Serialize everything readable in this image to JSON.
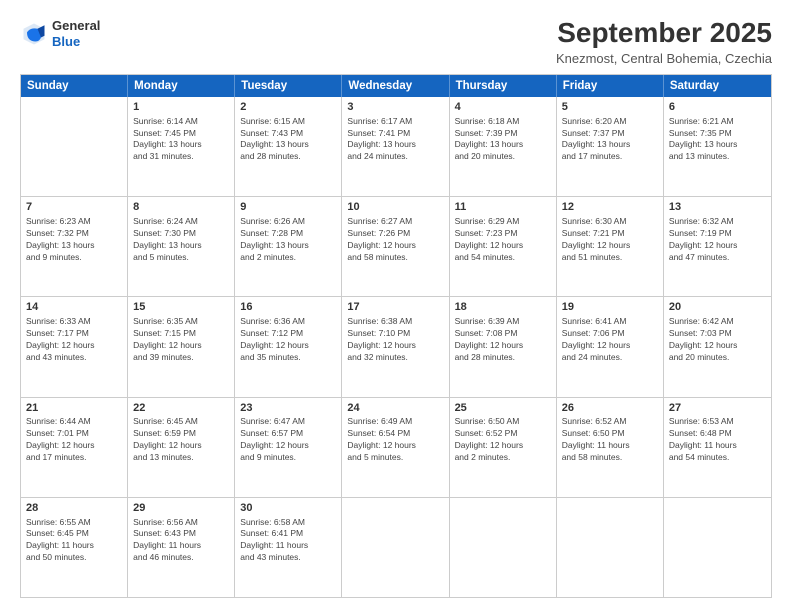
{
  "header": {
    "logo_line1": "General",
    "logo_line2": "Blue",
    "month": "September 2025",
    "location": "Knezmost, Central Bohemia, Czechia"
  },
  "weekdays": [
    "Sunday",
    "Monday",
    "Tuesday",
    "Wednesday",
    "Thursday",
    "Friday",
    "Saturday"
  ],
  "rows": [
    [
      {
        "day": "",
        "lines": []
      },
      {
        "day": "1",
        "lines": [
          "Sunrise: 6:14 AM",
          "Sunset: 7:45 PM",
          "Daylight: 13 hours",
          "and 31 minutes."
        ]
      },
      {
        "day": "2",
        "lines": [
          "Sunrise: 6:15 AM",
          "Sunset: 7:43 PM",
          "Daylight: 13 hours",
          "and 28 minutes."
        ]
      },
      {
        "day": "3",
        "lines": [
          "Sunrise: 6:17 AM",
          "Sunset: 7:41 PM",
          "Daylight: 13 hours",
          "and 24 minutes."
        ]
      },
      {
        "day": "4",
        "lines": [
          "Sunrise: 6:18 AM",
          "Sunset: 7:39 PM",
          "Daylight: 13 hours",
          "and 20 minutes."
        ]
      },
      {
        "day": "5",
        "lines": [
          "Sunrise: 6:20 AM",
          "Sunset: 7:37 PM",
          "Daylight: 13 hours",
          "and 17 minutes."
        ]
      },
      {
        "day": "6",
        "lines": [
          "Sunrise: 6:21 AM",
          "Sunset: 7:35 PM",
          "Daylight: 13 hours",
          "and 13 minutes."
        ]
      }
    ],
    [
      {
        "day": "7",
        "lines": [
          "Sunrise: 6:23 AM",
          "Sunset: 7:32 PM",
          "Daylight: 13 hours",
          "and 9 minutes."
        ]
      },
      {
        "day": "8",
        "lines": [
          "Sunrise: 6:24 AM",
          "Sunset: 7:30 PM",
          "Daylight: 13 hours",
          "and 5 minutes."
        ]
      },
      {
        "day": "9",
        "lines": [
          "Sunrise: 6:26 AM",
          "Sunset: 7:28 PM",
          "Daylight: 13 hours",
          "and 2 minutes."
        ]
      },
      {
        "day": "10",
        "lines": [
          "Sunrise: 6:27 AM",
          "Sunset: 7:26 PM",
          "Daylight: 12 hours",
          "and 58 minutes."
        ]
      },
      {
        "day": "11",
        "lines": [
          "Sunrise: 6:29 AM",
          "Sunset: 7:23 PM",
          "Daylight: 12 hours",
          "and 54 minutes."
        ]
      },
      {
        "day": "12",
        "lines": [
          "Sunrise: 6:30 AM",
          "Sunset: 7:21 PM",
          "Daylight: 12 hours",
          "and 51 minutes."
        ]
      },
      {
        "day": "13",
        "lines": [
          "Sunrise: 6:32 AM",
          "Sunset: 7:19 PM",
          "Daylight: 12 hours",
          "and 47 minutes."
        ]
      }
    ],
    [
      {
        "day": "14",
        "lines": [
          "Sunrise: 6:33 AM",
          "Sunset: 7:17 PM",
          "Daylight: 12 hours",
          "and 43 minutes."
        ]
      },
      {
        "day": "15",
        "lines": [
          "Sunrise: 6:35 AM",
          "Sunset: 7:15 PM",
          "Daylight: 12 hours",
          "and 39 minutes."
        ]
      },
      {
        "day": "16",
        "lines": [
          "Sunrise: 6:36 AM",
          "Sunset: 7:12 PM",
          "Daylight: 12 hours",
          "and 35 minutes."
        ]
      },
      {
        "day": "17",
        "lines": [
          "Sunrise: 6:38 AM",
          "Sunset: 7:10 PM",
          "Daylight: 12 hours",
          "and 32 minutes."
        ]
      },
      {
        "day": "18",
        "lines": [
          "Sunrise: 6:39 AM",
          "Sunset: 7:08 PM",
          "Daylight: 12 hours",
          "and 28 minutes."
        ]
      },
      {
        "day": "19",
        "lines": [
          "Sunrise: 6:41 AM",
          "Sunset: 7:06 PM",
          "Daylight: 12 hours",
          "and 24 minutes."
        ]
      },
      {
        "day": "20",
        "lines": [
          "Sunrise: 6:42 AM",
          "Sunset: 7:03 PM",
          "Daylight: 12 hours",
          "and 20 minutes."
        ]
      }
    ],
    [
      {
        "day": "21",
        "lines": [
          "Sunrise: 6:44 AM",
          "Sunset: 7:01 PM",
          "Daylight: 12 hours",
          "and 17 minutes."
        ]
      },
      {
        "day": "22",
        "lines": [
          "Sunrise: 6:45 AM",
          "Sunset: 6:59 PM",
          "Daylight: 12 hours",
          "and 13 minutes."
        ]
      },
      {
        "day": "23",
        "lines": [
          "Sunrise: 6:47 AM",
          "Sunset: 6:57 PM",
          "Daylight: 12 hours",
          "and 9 minutes."
        ]
      },
      {
        "day": "24",
        "lines": [
          "Sunrise: 6:49 AM",
          "Sunset: 6:54 PM",
          "Daylight: 12 hours",
          "and 5 minutes."
        ]
      },
      {
        "day": "25",
        "lines": [
          "Sunrise: 6:50 AM",
          "Sunset: 6:52 PM",
          "Daylight: 12 hours",
          "and 2 minutes."
        ]
      },
      {
        "day": "26",
        "lines": [
          "Sunrise: 6:52 AM",
          "Sunset: 6:50 PM",
          "Daylight: 11 hours",
          "and 58 minutes."
        ]
      },
      {
        "day": "27",
        "lines": [
          "Sunrise: 6:53 AM",
          "Sunset: 6:48 PM",
          "Daylight: 11 hours",
          "and 54 minutes."
        ]
      }
    ],
    [
      {
        "day": "28",
        "lines": [
          "Sunrise: 6:55 AM",
          "Sunset: 6:45 PM",
          "Daylight: 11 hours",
          "and 50 minutes."
        ]
      },
      {
        "day": "29",
        "lines": [
          "Sunrise: 6:56 AM",
          "Sunset: 6:43 PM",
          "Daylight: 11 hours",
          "and 46 minutes."
        ]
      },
      {
        "day": "30",
        "lines": [
          "Sunrise: 6:58 AM",
          "Sunset: 6:41 PM",
          "Daylight: 11 hours",
          "and 43 minutes."
        ]
      },
      {
        "day": "",
        "lines": []
      },
      {
        "day": "",
        "lines": []
      },
      {
        "day": "",
        "lines": []
      },
      {
        "day": "",
        "lines": []
      }
    ]
  ]
}
